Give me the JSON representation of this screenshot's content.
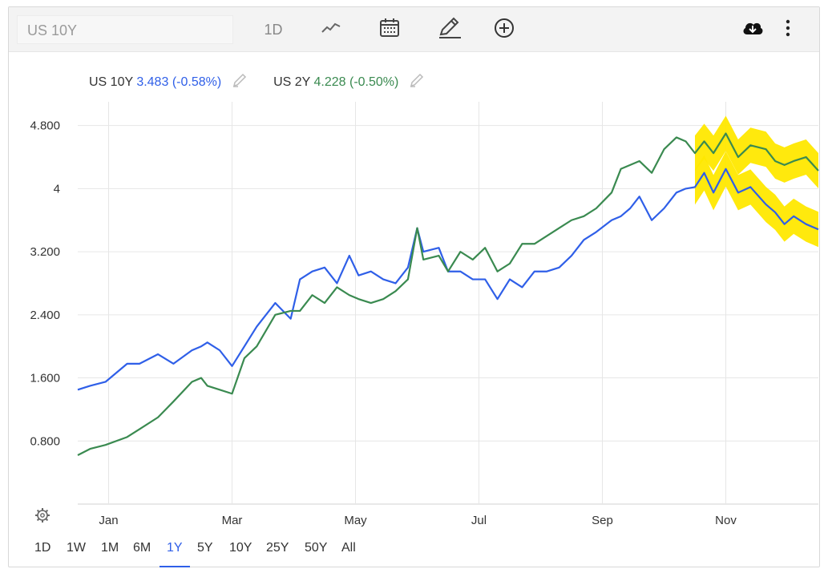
{
  "toolbar": {
    "symbol": "US 10Y",
    "interval": "1D",
    "icons": [
      "line-chart-icon",
      "calendar-icon",
      "pencil-icon",
      "add-circle-icon",
      "cloud-download-icon",
      "more-vertical-icon"
    ]
  },
  "legend": {
    "us10y": {
      "name": "US 10Y",
      "value": "3.483",
      "change": "(-0.58%)"
    },
    "us2y": {
      "name": "US 2Y",
      "value": "4.228",
      "change": "(-0.50%)"
    }
  },
  "ranges": {
    "items": [
      "1D",
      "1W",
      "1M",
      "6M",
      "1Y",
      "5Y",
      "10Y",
      "25Y",
      "50Y",
      "All"
    ],
    "active": "1Y"
  },
  "colors": {
    "us10y": "#2f5fe8",
    "us2y": "#3a8a50",
    "highlight": "#ffe800",
    "grid": "#e6e6e6"
  },
  "chart_data": {
    "type": "line",
    "title": "",
    "xlabel": "",
    "ylabel": "",
    "ylim": [
      0.0,
      5.0
    ],
    "yticks": [
      "4.800",
      "4",
      "3.200",
      "2.400",
      "1.600",
      "0.800"
    ],
    "ytick_values": [
      4.8,
      4.0,
      3.2,
      2.4,
      1.6,
      0.8
    ],
    "xticks": [
      "Jan",
      "Mar",
      "May",
      "Jul",
      "Sep",
      "Nov"
    ],
    "xtick_months": [
      0.5,
      2.5,
      4.5,
      6.5,
      8.5,
      10.5
    ],
    "x_unit": "months since start of window",
    "series": [
      {
        "name": "US 10Y",
        "x": [
          0.0,
          0.2,
          0.45,
          0.8,
          1.0,
          1.3,
          1.55,
          1.85,
          2.0,
          2.1,
          2.3,
          2.5,
          2.7,
          2.9,
          3.2,
          3.45,
          3.6,
          3.8,
          4.0,
          4.2,
          4.4,
          4.55,
          4.75,
          4.95,
          5.15,
          5.35,
          5.5,
          5.6,
          5.85,
          6.0,
          6.2,
          6.4,
          6.6,
          6.8,
          7.0,
          7.2,
          7.4,
          7.6,
          7.8,
          8.0,
          8.2,
          8.4,
          8.65,
          8.8,
          8.95,
          9.1,
          9.3,
          9.5,
          9.7,
          9.85,
          10.0,
          10.15,
          10.3,
          10.5,
          10.7,
          10.9,
          11.15,
          11.3,
          11.45,
          11.6,
          11.8,
          12.0
        ],
        "values": [
          1.45,
          1.5,
          1.55,
          1.78,
          1.78,
          1.9,
          1.78,
          1.95,
          2.0,
          2.05,
          1.95,
          1.75,
          2.0,
          2.25,
          2.55,
          2.35,
          2.85,
          2.95,
          3.0,
          2.8,
          3.15,
          2.9,
          2.95,
          2.85,
          2.8,
          3.0,
          3.5,
          3.2,
          3.25,
          2.95,
          2.95,
          2.85,
          2.85,
          2.6,
          2.85,
          2.75,
          2.95,
          2.95,
          3.0,
          3.15,
          3.35,
          3.45,
          3.6,
          3.65,
          3.75,
          3.9,
          3.6,
          3.75,
          3.95,
          4.0,
          4.02,
          4.2,
          3.95,
          4.25,
          3.95,
          4.02,
          3.8,
          3.7,
          3.55,
          3.65,
          3.55,
          3.483
        ]
      },
      {
        "name": "US 2Y",
        "x": [
          0.0,
          0.2,
          0.45,
          0.8,
          1.0,
          1.3,
          1.55,
          1.85,
          2.0,
          2.1,
          2.3,
          2.5,
          2.7,
          2.9,
          3.2,
          3.45,
          3.6,
          3.8,
          4.0,
          4.2,
          4.4,
          4.55,
          4.75,
          4.95,
          5.15,
          5.35,
          5.5,
          5.6,
          5.85,
          6.0,
          6.2,
          6.4,
          6.6,
          6.8,
          7.0,
          7.2,
          7.4,
          7.6,
          7.8,
          8.0,
          8.2,
          8.4,
          8.65,
          8.8,
          8.95,
          9.1,
          9.3,
          9.5,
          9.7,
          9.85,
          10.0,
          10.15,
          10.3,
          10.5,
          10.7,
          10.9,
          11.15,
          11.3,
          11.45,
          11.6,
          11.8,
          12.0
        ],
        "values": [
          0.62,
          0.7,
          0.75,
          0.85,
          0.95,
          1.1,
          1.3,
          1.55,
          1.6,
          1.5,
          1.45,
          1.4,
          1.85,
          2.0,
          2.4,
          2.45,
          2.45,
          2.65,
          2.55,
          2.75,
          2.65,
          2.6,
          2.55,
          2.6,
          2.7,
          2.85,
          3.5,
          3.1,
          3.15,
          2.95,
          3.2,
          3.1,
          3.25,
          2.95,
          3.05,
          3.3,
          3.3,
          3.4,
          3.5,
          3.6,
          3.65,
          3.75,
          3.95,
          4.25,
          4.3,
          4.35,
          4.2,
          4.5,
          4.65,
          4.6,
          4.45,
          4.6,
          4.45,
          4.7,
          4.4,
          4.55,
          4.5,
          4.35,
          4.3,
          4.35,
          4.4,
          4.228
        ]
      }
    ],
    "annotation": {
      "type": "highlight-bands",
      "months_from": 10.0,
      "color": "#ffe800"
    },
    "grid": true,
    "legend_placement": "top-left"
  }
}
